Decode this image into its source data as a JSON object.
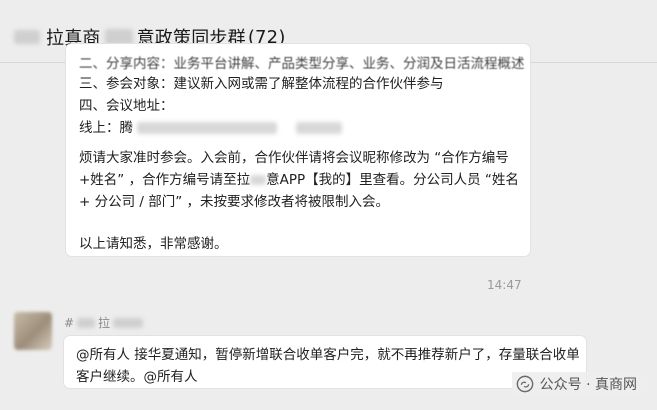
{
  "header": {
    "title_part1": "拉真商",
    "title_part2": "意政策同步群",
    "member_count": "(72)"
  },
  "message1": {
    "cut_line": "二、分享内容：业务平台讲解、产品类型分享、业务、分润及日活流程概述",
    "line_participants": "三、参会对象：建议新入网或需了解整体流程的合作伙伴参与",
    "line_address": "四、会议地址：",
    "line_online": "线上：腾",
    "para_naming": "烦请大家准时参会。入会前，合作伙伴请将会议昵称修改为 “合作方编号+姓名” ，合作方编号请至拉",
    "para_naming2": "意APP【我的】里查看。分公司人员 “姓名 + 分公司 / 部门” ，未按要求修改者将被限制入会。",
    "closing": "以上请知悉，非常感谢。"
  },
  "timestamp": "14:47",
  "message2": {
    "sender_prefix": "#",
    "sender_mid": "拉",
    "text": "@所有人 接华夏通知，暂停新增联合收单客户完，就不再推荐新户了，存量联合收单客户继续。@所有人"
  },
  "watermark": {
    "text": "公众号 · 真商网",
    "icon": "wechat-official-account-icon"
  }
}
